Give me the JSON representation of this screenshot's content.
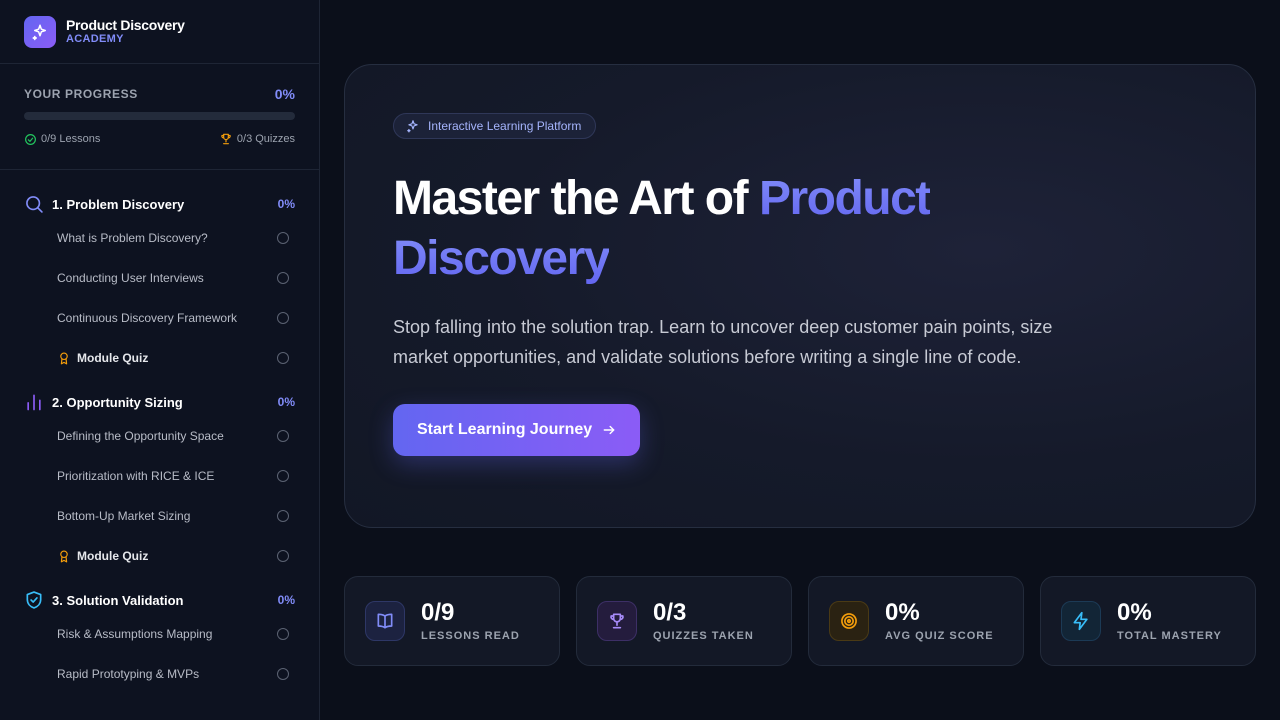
{
  "brand": {
    "title": "Product Discovery",
    "subtitle": "ACADEMY"
  },
  "progress": {
    "label": "YOUR PROGRESS",
    "percent": "0%",
    "fill_fraction": 0,
    "lessons": "0/9 Lessons",
    "quizzes": "0/3 Quizzes"
  },
  "modules": [
    {
      "title": "1. Problem Discovery",
      "percent": "0%",
      "icon": "search-icon",
      "lessons": [
        {
          "label": "What is Problem Discovery?"
        },
        {
          "label": "Conducting User Interviews"
        },
        {
          "label": "Continuous Discovery Framework"
        },
        {
          "label": "Module Quiz"
        }
      ]
    },
    {
      "title": "2. Opportunity Sizing",
      "percent": "0%",
      "icon": "bar-chart-icon",
      "lessons": [
        {
          "label": "Defining the Opportunity Space"
        },
        {
          "label": "Prioritization with RICE & ICE"
        },
        {
          "label": "Bottom-Up Market Sizing"
        },
        {
          "label": "Module Quiz"
        }
      ]
    },
    {
      "title": "3. Solution Validation",
      "percent": "0%",
      "icon": "shield-check-icon",
      "lessons": [
        {
          "label": "Risk & Assumptions Mapping"
        },
        {
          "label": "Rapid Prototyping & MVPs"
        }
      ]
    }
  ],
  "hero": {
    "badge": "Interactive Learning Platform",
    "title_plain": "Master the Art of ",
    "title_accent_1": "Product",
    "title_accent_2": "Discovery",
    "description": "Stop falling into the solution trap. Learn to uncover deep customer pain points, size market opportunities, and validate solutions before writing a single line of code.",
    "cta": "Start Learning Journey"
  },
  "stats": [
    {
      "value": "0/9",
      "label": "LESSONS READ",
      "icon": "book-icon"
    },
    {
      "value": "0/3",
      "label": "QUIZZES TAKEN",
      "icon": "trophy-icon"
    },
    {
      "value": "0%",
      "label": "AVG QUIZ SCORE",
      "icon": "target-icon"
    },
    {
      "value": "0%",
      "label": "TOTAL MASTERY",
      "icon": "lightning-icon"
    }
  ],
  "colors": {
    "accent": "#6366f1",
    "accent_light": "#818cf8",
    "background": "#0b0f1a",
    "quiz_icon": "#f59e0b",
    "success": "#22c55e"
  }
}
